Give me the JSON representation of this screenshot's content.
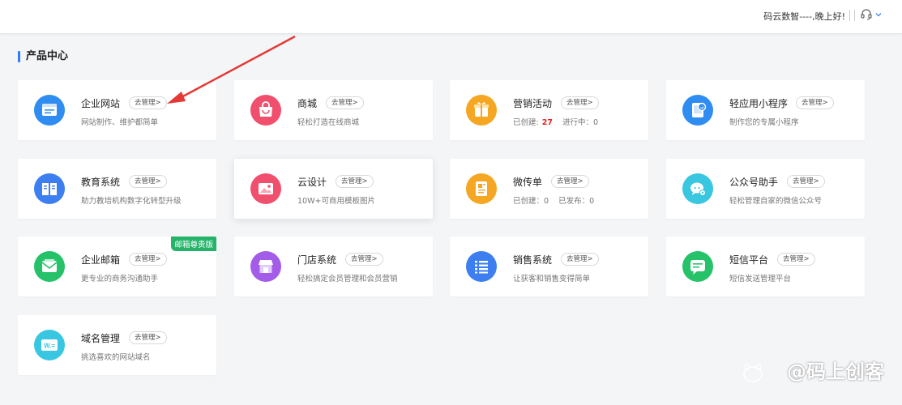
{
  "header": {
    "greeting": "码云数智----,晚上好!"
  },
  "section": {
    "title": "产品中心"
  },
  "cards": [
    {
      "title": "企业网站",
      "manage": "去管理>",
      "desc": "网站制作、维护都简单",
      "icon": "website-icon",
      "color": "#2f8cf0"
    },
    {
      "title": "商城",
      "manage": "去管理>",
      "desc": "轻松打造在线商城",
      "icon": "shopping-bag-icon",
      "color": "#f0506e"
    },
    {
      "title": "营销活动",
      "manage": "去管理>",
      "desc_prefix": "已创建:",
      "desc_num": "27",
      "desc_suffix": "进行中：0",
      "icon": "gift-icon",
      "color": "#f5a623"
    },
    {
      "title": "轻应用小程序",
      "manage": "去管理>",
      "desc": "制作您的专属小程序",
      "icon": "mini-program-icon",
      "color": "#2f8cf0"
    },
    {
      "title": "教育系统",
      "manage": "去管理>",
      "desc": "助力教培机构数字化转型升级",
      "icon": "book-icon",
      "color": "#3d7ef0"
    },
    {
      "title": "云设计",
      "manage": "去管理>",
      "desc": "10W+可商用模板图片",
      "icon": "image-icon",
      "color": "#f0506e"
    },
    {
      "title": "微传单",
      "manage": "去管理>",
      "desc": "已创建：0    已发布：0",
      "icon": "flyer-icon",
      "color": "#f5a623"
    },
    {
      "title": "公众号助手",
      "manage": "去管理>",
      "desc": "轻松管理自家的微信公众号",
      "icon": "wechat-icon",
      "color": "#38c6e0"
    },
    {
      "title": "企业邮箱",
      "manage": "去管理>",
      "desc": "更专业的商务沟通助手",
      "icon": "mail-icon",
      "color": "#25c26a",
      "badge": "邮箱尊贵版"
    },
    {
      "title": "门店系统",
      "manage": "去管理>",
      "desc": "轻松搞定会员管理和会员营销",
      "icon": "store-icon",
      "color": "#a35ce8"
    },
    {
      "title": "销售系统",
      "manage": "去管理>",
      "desc": "让获客和销售变得简单",
      "icon": "list-icon",
      "color": "#3d7ef0"
    },
    {
      "title": "短信平台",
      "manage": "去管理>",
      "desc": "短信发送管理平台",
      "icon": "sms-icon",
      "color": "#25c26a"
    },
    {
      "title": "域名管理",
      "manage": "去管理>",
      "desc": "挑选喜欢的网站域名",
      "icon": "domain-icon",
      "color": "#38c6e0"
    }
  ],
  "watermark": "@码上创客"
}
